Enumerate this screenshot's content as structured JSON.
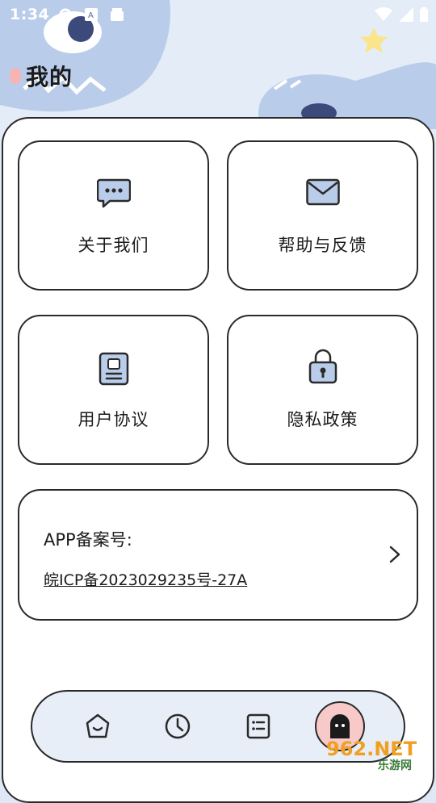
{
  "status_bar": {
    "time": "1:34"
  },
  "page": {
    "title": "我的"
  },
  "cards": [
    {
      "label": "关于我们",
      "icon": "chat-bubble-icon"
    },
    {
      "label": "帮助与反馈",
      "icon": "mail-icon"
    },
    {
      "label": "用户协议",
      "icon": "document-icon"
    },
    {
      "label": "隐私政策",
      "icon": "lock-icon"
    }
  ],
  "icp": {
    "label": "APP备案号:",
    "value": "皖ICP备2023029235号-27A"
  },
  "bottom_nav": {
    "items": [
      "home-icon",
      "clock-icon",
      "list-icon",
      "profile-ghost-icon"
    ],
    "active": "profile-ghost-icon"
  },
  "watermark": {
    "text": "962.NET",
    "sub": "乐游网"
  },
  "colors": {
    "accent": "#b9cdea",
    "active_bg": "#f7c9c9",
    "border": "#2a2a2a"
  }
}
